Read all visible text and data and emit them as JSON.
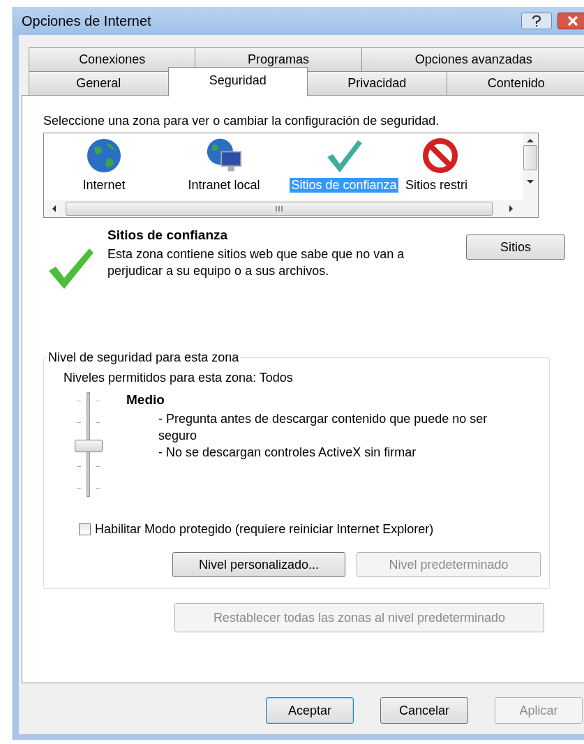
{
  "window": {
    "title": "Opciones de Internet"
  },
  "tab_rows": [
    [
      {
        "label": "Conexiones",
        "selected": false
      },
      {
        "label": "Programas",
        "selected": false
      },
      {
        "label": "Opciones avanzadas",
        "selected": false
      }
    ],
    [
      {
        "label": "General",
        "selected": false
      },
      {
        "label": "Seguridad",
        "selected": true
      },
      {
        "label": "Privacidad",
        "selected": false
      },
      {
        "label": "Contenido",
        "selected": false
      }
    ]
  ],
  "zones": {
    "prompt": "Seleccione una zona para ver o cambiar la configuración de seguridad.",
    "items": [
      {
        "kind": "internet",
        "label": "Internet",
        "selected": false
      },
      {
        "kind": "intranet",
        "label": "Intranet local",
        "selected": false
      },
      {
        "kind": "trusted",
        "label": "Sitios de confianza",
        "selected": true
      },
      {
        "kind": "restricted",
        "label": "Sitios restri",
        "selected": false
      }
    ]
  },
  "zone_info": {
    "kind": "trusted",
    "title": "Sitios de confianza",
    "description": "Esta zona contiene sitios web que sabe que no van a perjudicar a su equipo o a sus archivos.",
    "button": "Sitios"
  },
  "security_level": {
    "legend": "Nivel de seguridad para esta zona",
    "allowed": "Niveles permitidos para esta zona: Todos",
    "slider": {
      "level": 0.5
    },
    "level_name": "Medio",
    "bullets": [
      "- Pregunta antes de descargar contenido que puede no ser seguro",
      "- No se descargan controles ActiveX sin firmar"
    ],
    "protected_mode": {
      "label": "Habilitar Modo protegido (requiere reiniciar Internet Explorer)",
      "checked": false
    },
    "buttons": [
      {
        "label": "Nivel personalizado...",
        "disabled": false
      },
      {
        "label": "Nivel predeterminado",
        "disabled": true
      }
    ]
  },
  "reset_button": {
    "label": "Restablecer todas las zonas al nivel predeterminado",
    "disabled": true
  },
  "footer_buttons": [
    {
      "label": "Aceptar",
      "default": true,
      "disabled": false
    },
    {
      "label": "Cancelar",
      "default": false,
      "disabled": false
    },
    {
      "label": "Aplicar",
      "default": false,
      "disabled": true
    }
  ]
}
